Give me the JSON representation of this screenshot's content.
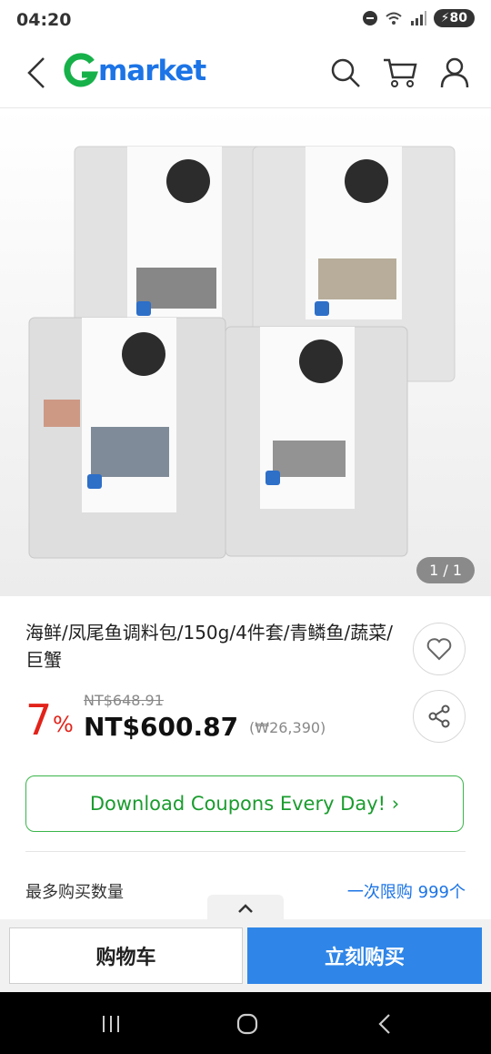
{
  "status_bar": {
    "time": "04:20",
    "battery": "80"
  },
  "header": {
    "logo_text": "market"
  },
  "gallery": {
    "pager": "1 / 1"
  },
  "product": {
    "title": "海鲜/凤尾鱼调料包/150g/4件套/青鳞鱼/蔬菜/巨蟹",
    "discount": "7",
    "discount_unit": "%",
    "original_price": "NT$648.91",
    "price": "NT$600.87",
    "price_krw": "(₩26,390)"
  },
  "coupon": {
    "label": "Download Coupons Every Day! ›"
  },
  "purchase_limit": {
    "label": "最多购买数量",
    "value": "一次限购 999个"
  },
  "actions": {
    "cart_label": "购物车",
    "buy_label": "立刻购买"
  },
  "colors": {
    "brand_green": "#17b14a",
    "brand_blue": "#1c74e6",
    "discount_red": "#e2231a",
    "buy_blue": "#2f86e8"
  }
}
